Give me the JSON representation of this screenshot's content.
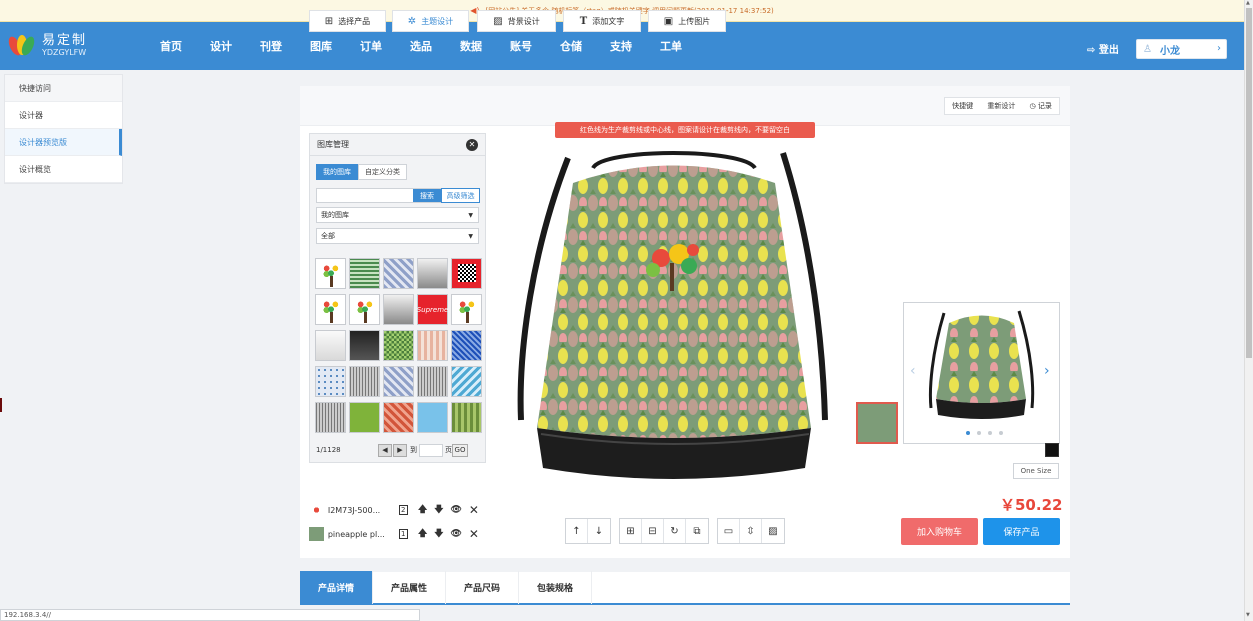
{
  "notice": {
    "icon": "speaker-icon",
    "text": "[网站公告] 关于多个 随机标签（rtag）或随机关键字 调用问题更新(2018-01-17 14:37:52)"
  },
  "header": {
    "logo_cn": "易定制",
    "logo_en": "YDZGYLFW",
    "nav": [
      "首页",
      "设计",
      "刊登",
      "图库",
      "订单",
      "选品",
      "数据",
      "账号",
      "仓储",
      "支持",
      "工单"
    ],
    "logout": "登出",
    "user": "小龙"
  },
  "sidebar": {
    "items": [
      {
        "label": "快捷访问"
      },
      {
        "label": "设计器"
      },
      {
        "label": "设计器预览版"
      },
      {
        "label": "设计概览"
      }
    ]
  },
  "toolbar": {
    "buttons": [
      {
        "icon": "grid-icon",
        "label": "选择产品"
      },
      {
        "icon": "theme-icon",
        "label": "主题设计"
      },
      {
        "icon": "hatch-icon",
        "label": "背景设计"
      },
      {
        "icon": "text-icon",
        "label": "添加文字"
      },
      {
        "icon": "image-icon",
        "label": "上传图片"
      }
    ],
    "right": {
      "shortcut": "快捷键",
      "redesign": "重新设计",
      "record": "记录"
    }
  },
  "tip": "红色线为生产裁剪线或中心线，图案请设计在裁剪线内，不要留空白",
  "library": {
    "title": "图库管理",
    "tabs": [
      "我的图库",
      "自定义分类"
    ],
    "search_button": "搜索",
    "advanced": "高级筛选",
    "select1": "我的图库",
    "select2": "全部",
    "pager": {
      "page": "1/1128",
      "to": "到",
      "page_unit": "页",
      "go": "GO"
    },
    "thumb_supreme": "Supreme"
  },
  "layers": [
    {
      "name": "I2M73J-500...",
      "num": "2"
    },
    {
      "name": "pineapple pl...",
      "num": "1"
    }
  ],
  "product": {
    "size": "One Size",
    "price": "￥50.22",
    "add_cart": "加入购物车",
    "save": "保存产品"
  },
  "detail_tabs": [
    "产品详情",
    "产品属性",
    "产品尺码",
    "包装规格"
  ],
  "statusbar": "192.168.3.4//",
  "colors": {
    "primary": "#3b8bd3",
    "price": "#e8473b",
    "cart": "#f06b6b",
    "save": "#1e93ea",
    "pattern_bg": "#7d9c78"
  }
}
